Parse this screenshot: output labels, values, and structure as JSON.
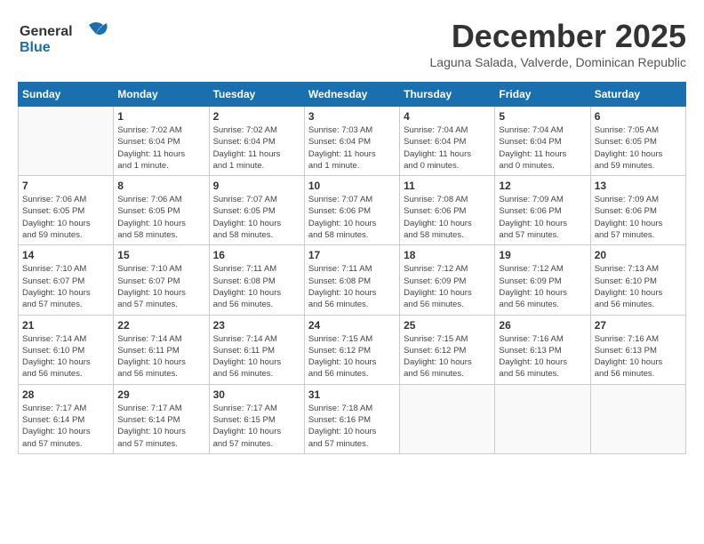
{
  "header": {
    "logo_line1": "General",
    "logo_line2": "Blue",
    "month": "December 2025",
    "location": "Laguna Salada, Valverde, Dominican Republic"
  },
  "weekdays": [
    "Sunday",
    "Monday",
    "Tuesday",
    "Wednesday",
    "Thursday",
    "Friday",
    "Saturday"
  ],
  "weeks": [
    [
      {
        "day": "",
        "info": ""
      },
      {
        "day": "1",
        "info": "Sunrise: 7:02 AM\nSunset: 6:04 PM\nDaylight: 11 hours\nand 1 minute."
      },
      {
        "day": "2",
        "info": "Sunrise: 7:02 AM\nSunset: 6:04 PM\nDaylight: 11 hours\nand 1 minute."
      },
      {
        "day": "3",
        "info": "Sunrise: 7:03 AM\nSunset: 6:04 PM\nDaylight: 11 hours\nand 1 minute."
      },
      {
        "day": "4",
        "info": "Sunrise: 7:04 AM\nSunset: 6:04 PM\nDaylight: 11 hours\nand 0 minutes."
      },
      {
        "day": "5",
        "info": "Sunrise: 7:04 AM\nSunset: 6:04 PM\nDaylight: 11 hours\nand 0 minutes."
      },
      {
        "day": "6",
        "info": "Sunrise: 7:05 AM\nSunset: 6:05 PM\nDaylight: 10 hours\nand 59 minutes."
      }
    ],
    [
      {
        "day": "7",
        "info": "Sunrise: 7:06 AM\nSunset: 6:05 PM\nDaylight: 10 hours\nand 59 minutes."
      },
      {
        "day": "8",
        "info": "Sunrise: 7:06 AM\nSunset: 6:05 PM\nDaylight: 10 hours\nand 58 minutes."
      },
      {
        "day": "9",
        "info": "Sunrise: 7:07 AM\nSunset: 6:05 PM\nDaylight: 10 hours\nand 58 minutes."
      },
      {
        "day": "10",
        "info": "Sunrise: 7:07 AM\nSunset: 6:06 PM\nDaylight: 10 hours\nand 58 minutes."
      },
      {
        "day": "11",
        "info": "Sunrise: 7:08 AM\nSunset: 6:06 PM\nDaylight: 10 hours\nand 58 minutes."
      },
      {
        "day": "12",
        "info": "Sunrise: 7:09 AM\nSunset: 6:06 PM\nDaylight: 10 hours\nand 57 minutes."
      },
      {
        "day": "13",
        "info": "Sunrise: 7:09 AM\nSunset: 6:06 PM\nDaylight: 10 hours\nand 57 minutes."
      }
    ],
    [
      {
        "day": "14",
        "info": "Sunrise: 7:10 AM\nSunset: 6:07 PM\nDaylight: 10 hours\nand 57 minutes."
      },
      {
        "day": "15",
        "info": "Sunrise: 7:10 AM\nSunset: 6:07 PM\nDaylight: 10 hours\nand 57 minutes."
      },
      {
        "day": "16",
        "info": "Sunrise: 7:11 AM\nSunset: 6:08 PM\nDaylight: 10 hours\nand 56 minutes."
      },
      {
        "day": "17",
        "info": "Sunrise: 7:11 AM\nSunset: 6:08 PM\nDaylight: 10 hours\nand 56 minutes."
      },
      {
        "day": "18",
        "info": "Sunrise: 7:12 AM\nSunset: 6:09 PM\nDaylight: 10 hours\nand 56 minutes."
      },
      {
        "day": "19",
        "info": "Sunrise: 7:12 AM\nSunset: 6:09 PM\nDaylight: 10 hours\nand 56 minutes."
      },
      {
        "day": "20",
        "info": "Sunrise: 7:13 AM\nSunset: 6:10 PM\nDaylight: 10 hours\nand 56 minutes."
      }
    ],
    [
      {
        "day": "21",
        "info": "Sunrise: 7:14 AM\nSunset: 6:10 PM\nDaylight: 10 hours\nand 56 minutes."
      },
      {
        "day": "22",
        "info": "Sunrise: 7:14 AM\nSunset: 6:11 PM\nDaylight: 10 hours\nand 56 minutes."
      },
      {
        "day": "23",
        "info": "Sunrise: 7:14 AM\nSunset: 6:11 PM\nDaylight: 10 hours\nand 56 minutes."
      },
      {
        "day": "24",
        "info": "Sunrise: 7:15 AM\nSunset: 6:12 PM\nDaylight: 10 hours\nand 56 minutes."
      },
      {
        "day": "25",
        "info": "Sunrise: 7:15 AM\nSunset: 6:12 PM\nDaylight: 10 hours\nand 56 minutes."
      },
      {
        "day": "26",
        "info": "Sunrise: 7:16 AM\nSunset: 6:13 PM\nDaylight: 10 hours\nand 56 minutes."
      },
      {
        "day": "27",
        "info": "Sunrise: 7:16 AM\nSunset: 6:13 PM\nDaylight: 10 hours\nand 56 minutes."
      }
    ],
    [
      {
        "day": "28",
        "info": "Sunrise: 7:17 AM\nSunset: 6:14 PM\nDaylight: 10 hours\nand 57 minutes."
      },
      {
        "day": "29",
        "info": "Sunrise: 7:17 AM\nSunset: 6:14 PM\nDaylight: 10 hours\nand 57 minutes."
      },
      {
        "day": "30",
        "info": "Sunrise: 7:17 AM\nSunset: 6:15 PM\nDaylight: 10 hours\nand 57 minutes."
      },
      {
        "day": "31",
        "info": "Sunrise: 7:18 AM\nSunset: 6:16 PM\nDaylight: 10 hours\nand 57 minutes."
      },
      {
        "day": "",
        "info": ""
      },
      {
        "day": "",
        "info": ""
      },
      {
        "day": "",
        "info": ""
      }
    ]
  ]
}
